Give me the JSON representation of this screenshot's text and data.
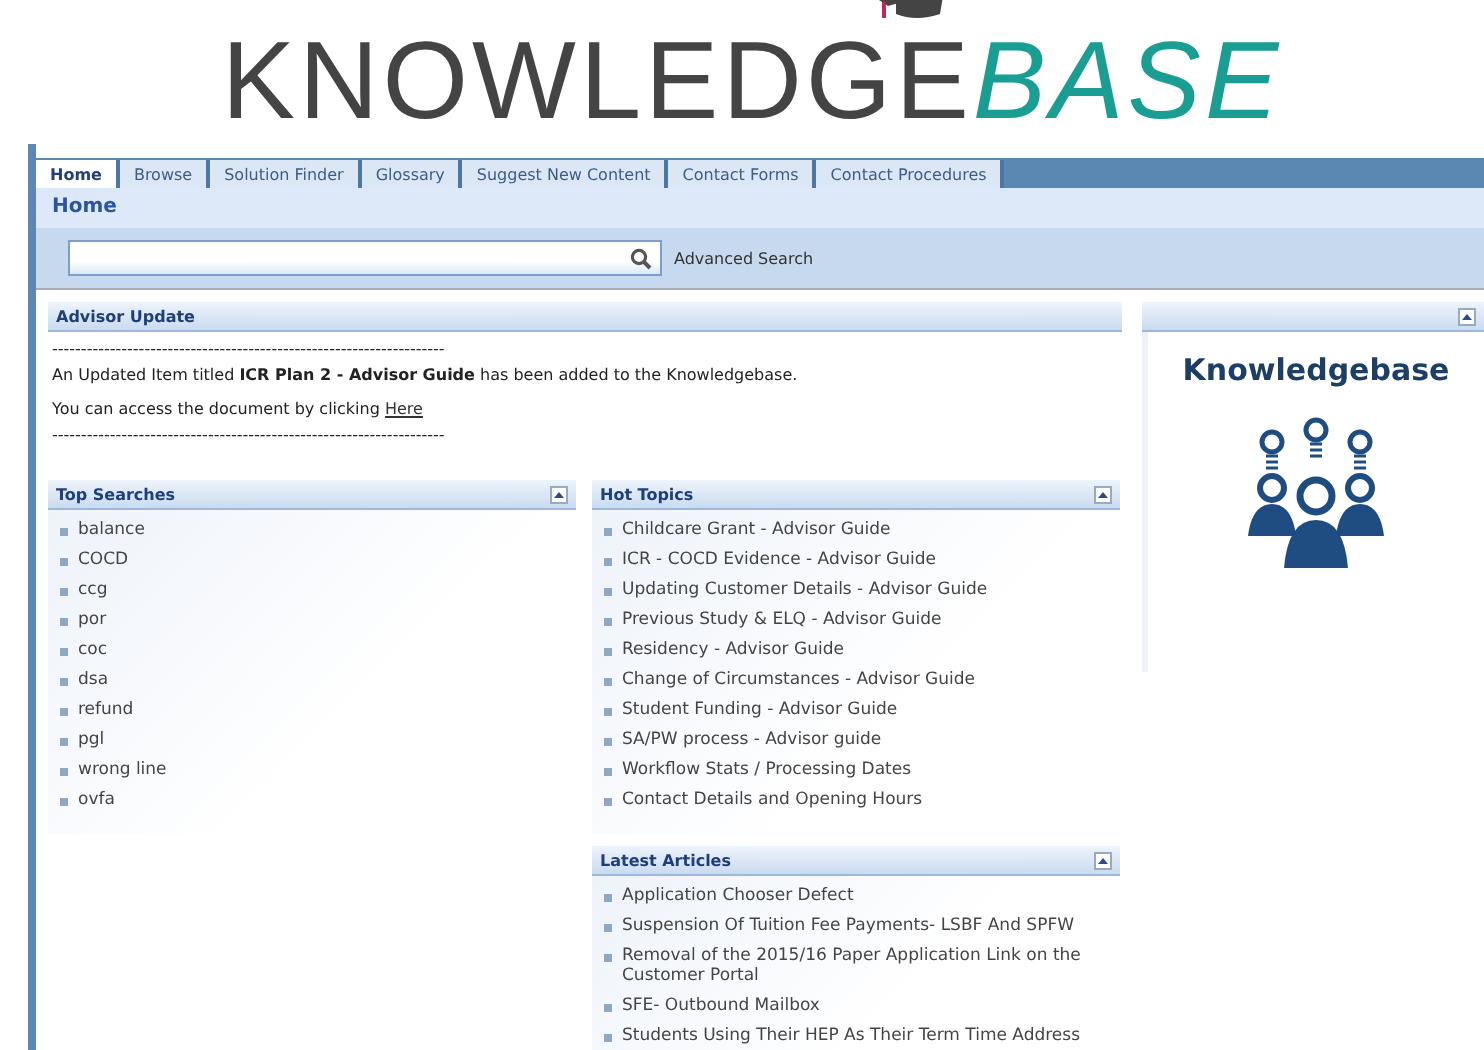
{
  "logo": {
    "first": "KNOWLEDGE",
    "second": "BASE"
  },
  "tabs": [
    {
      "label": "Home",
      "selected": true
    },
    {
      "label": "Browse",
      "selected": false
    },
    {
      "label": "Solution Finder",
      "selected": false
    },
    {
      "label": "Glossary",
      "selected": false
    },
    {
      "label": "Suggest New Content",
      "selected": false
    },
    {
      "label": "Contact Forms",
      "selected": false
    },
    {
      "label": "Contact Procedures",
      "selected": false
    }
  ],
  "page_title": "Home",
  "search": {
    "advanced_link": "Advanced Search"
  },
  "advisor_update": {
    "title": "Advisor Update",
    "rule": "--------------------------------------------------------------------",
    "message": "An Updated Item titled **ICR Plan 2 - Advisor Guide** has been added to the Knowledgebase.",
    "access_text": "You can access the document by clicking",
    "link": "Here"
  },
  "top_searches": {
    "title": "Top Searches",
    "items": [
      "balance",
      "COCD",
      "ccg",
      "por",
      "coc",
      "dsa",
      "refund",
      "pgl",
      "wrong line",
      "ovfa"
    ]
  },
  "hot_topics": {
    "title": "Hot Topics",
    "items": [
      "Childcare Grant - Advisor Guide",
      "ICR - COCD Evidence - Advisor Guide",
      "Updating Customer Details - Advisor Guide",
      "Previous Study & ELQ - Advisor Guide",
      "Residency - Advisor Guide",
      "Change of Circumstances - Advisor Guide",
      "Student Funding - Advisor Guide",
      "SA/PW process - Advisor guide",
      "Workflow Stats / Processing Dates",
      "Contact Details and Opening Hours"
    ]
  },
  "latest_articles": {
    "title": "Latest Articles",
    "items": [
      "Application Chooser Defect",
      "Suspension Of Tuition Fee Payments- LSBF And SPFW",
      "Removal of the 2015/16 Paper Application Link on the Customer Portal",
      "SFE- Outbound Mailbox",
      "Students Using Their HEP As Their Term Time Address"
    ]
  },
  "side_panel": {
    "heading": "Knowledgebase"
  }
}
